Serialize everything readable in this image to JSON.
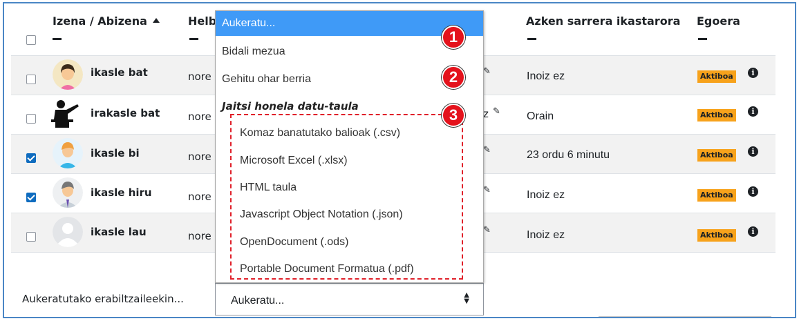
{
  "header": {
    "col_name": "Izena / Abizena",
    "col_email_partial": "Helb",
    "col_last_access": "Azken sarrera ikastarora",
    "col_status": "Egoera"
  },
  "rows": [
    {
      "name": "ikasle bat",
      "email_partial": "nore",
      "last_access": "Inoiz ez",
      "status": "Aktiboa",
      "checked": false
    },
    {
      "name": "irakasle bat",
      "email_partial": "nore",
      "last_access": "Orain",
      "status": "Aktiboa",
      "checked": false
    },
    {
      "name": "ikasle bi",
      "email_partial": "nore",
      "last_access": "23 ordu 6 minutu",
      "status": "Aktiboa",
      "checked": true
    },
    {
      "name": "ikasle hiru",
      "email_partial": "nore",
      "last_access": "Inoiz ez",
      "status": "Aktiboa",
      "checked": true
    },
    {
      "name": "ikasle lau",
      "email_partial": "nore",
      "last_access": "Inoiz ez",
      "status": "Aktiboa",
      "checked": false
    }
  ],
  "row2_trailing": "z",
  "dropdown": {
    "selected": "Aukeratu...",
    "items": [
      "Bidali mezua",
      "Gehitu ohar berria"
    ],
    "group_label": "Jaitsi honela datu-taula",
    "group_items": [
      "Komaz banatutako balioak (.csv)",
      "Microsoft Excel (.xlsx)",
      "HTML taula",
      "Javascript Object Notation (.json)",
      "OpenDocument (.ods)",
      "Portable Document Formatua (.pdf)"
    ]
  },
  "callouts": [
    "1",
    "2",
    "3"
  ],
  "bulk": {
    "label": "Aukeratutako erabiltzaileekin...",
    "select_value": "Aukeratu..."
  },
  "colors": {
    "selected_bg": "#3f9af7",
    "badge_bg": "#f7a21b",
    "callout_red": "#e4121c",
    "checkbox_checked": "#0f6cbf"
  }
}
